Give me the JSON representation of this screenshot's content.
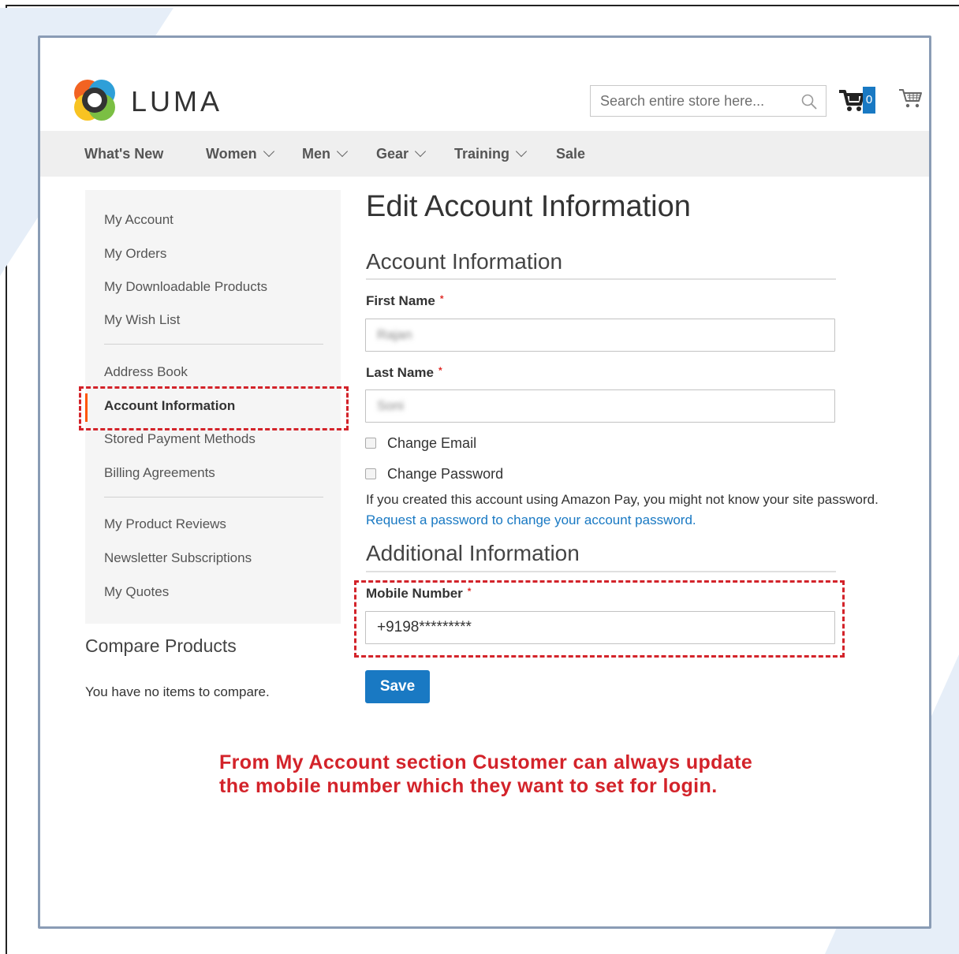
{
  "brand": {
    "name": "LUMA"
  },
  "header": {
    "search_placeholder": "Search entire store here...",
    "cart_count": "0",
    "icons": {
      "search": "search-icon",
      "compare": "compare-cart-icon",
      "minicart": "shopping-cart-icon"
    }
  },
  "nav": {
    "items": [
      {
        "label": "What's New",
        "has_dropdown": false
      },
      {
        "label": "Women",
        "has_dropdown": true
      },
      {
        "label": "Men",
        "has_dropdown": true
      },
      {
        "label": "Gear",
        "has_dropdown": true
      },
      {
        "label": "Training",
        "has_dropdown": true
      },
      {
        "label": "Sale",
        "has_dropdown": false
      }
    ]
  },
  "sidebar": {
    "items": [
      {
        "label": "My Account"
      },
      {
        "label": "My Orders"
      },
      {
        "label": "My Downloadable Products"
      },
      {
        "label": "My Wish List"
      },
      {
        "label": "Address Book"
      },
      {
        "label": "Account Information",
        "active": true
      },
      {
        "label": "Stored Payment Methods"
      },
      {
        "label": "Billing Agreements"
      },
      {
        "label": "My Product Reviews"
      },
      {
        "label": "Newsletter Subscriptions"
      },
      {
        "label": "My Quotes"
      }
    ],
    "compare": {
      "title": "Compare Products",
      "empty_text": "You have no items to compare."
    }
  },
  "main": {
    "page_title": "Edit Account Information",
    "account_section": {
      "title": "Account Information",
      "first_name": {
        "label": "First Name",
        "required": "*",
        "value": "Rajan"
      },
      "last_name": {
        "label": "Last Name",
        "required": "*",
        "value": "Soni"
      },
      "change_email": {
        "label": "Change Email",
        "checked": false
      },
      "change_password": {
        "label": "Change Password",
        "checked": false
      },
      "amazon_note": "If you created this account using Amazon Pay, you might not know your site password.",
      "amazon_link": "Request a password to change your account password."
    },
    "additional_section": {
      "title": "Additional Information",
      "mobile": {
        "label": "Mobile Number",
        "required": "*",
        "value": "+9198*********"
      }
    },
    "save_label": "Save"
  },
  "annotation": {
    "line1": "From My Account section Customer can always update",
    "line2": "the mobile number which they want to set for login.",
    "color": "#d3232a"
  },
  "colors": {
    "accent": "#1979c3",
    "active_marker": "#ff5501",
    "highlight": "#d3232a"
  }
}
